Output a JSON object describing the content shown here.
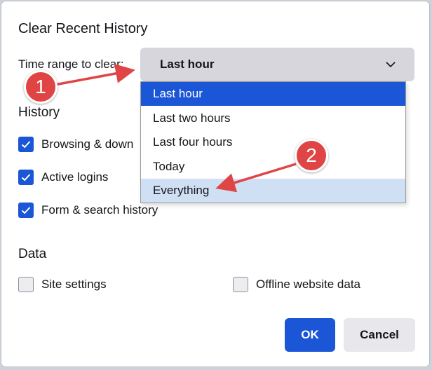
{
  "dialog": {
    "title": "Clear Recent History",
    "time_range_label": "Time range to clear:",
    "selected_range": "Last hour",
    "range_options": [
      "Last hour",
      "Last two hours",
      "Last four hours",
      "Today",
      "Everything"
    ],
    "highlighted_option": "Last hour",
    "hovered_option": "Everything",
    "history_heading": "History",
    "history_items": [
      {
        "label": "Browsing & down",
        "checked": true
      },
      {
        "label": "Active logins",
        "checked": true
      },
      {
        "label": "Form & search history",
        "checked": true
      }
    ],
    "data_heading": "Data",
    "data_items": [
      {
        "label": "Site settings",
        "checked": false
      },
      {
        "label": "Offline website data",
        "checked": false
      }
    ],
    "ok_label": "OK",
    "cancel_label": "Cancel"
  },
  "annotations": {
    "marker_1": "1",
    "marker_2": "2",
    "color": "#e04545"
  },
  "colors": {
    "accent": "#1a56d6",
    "hover": "#cfe0f5",
    "select_bg": "#d6d6dc"
  }
}
